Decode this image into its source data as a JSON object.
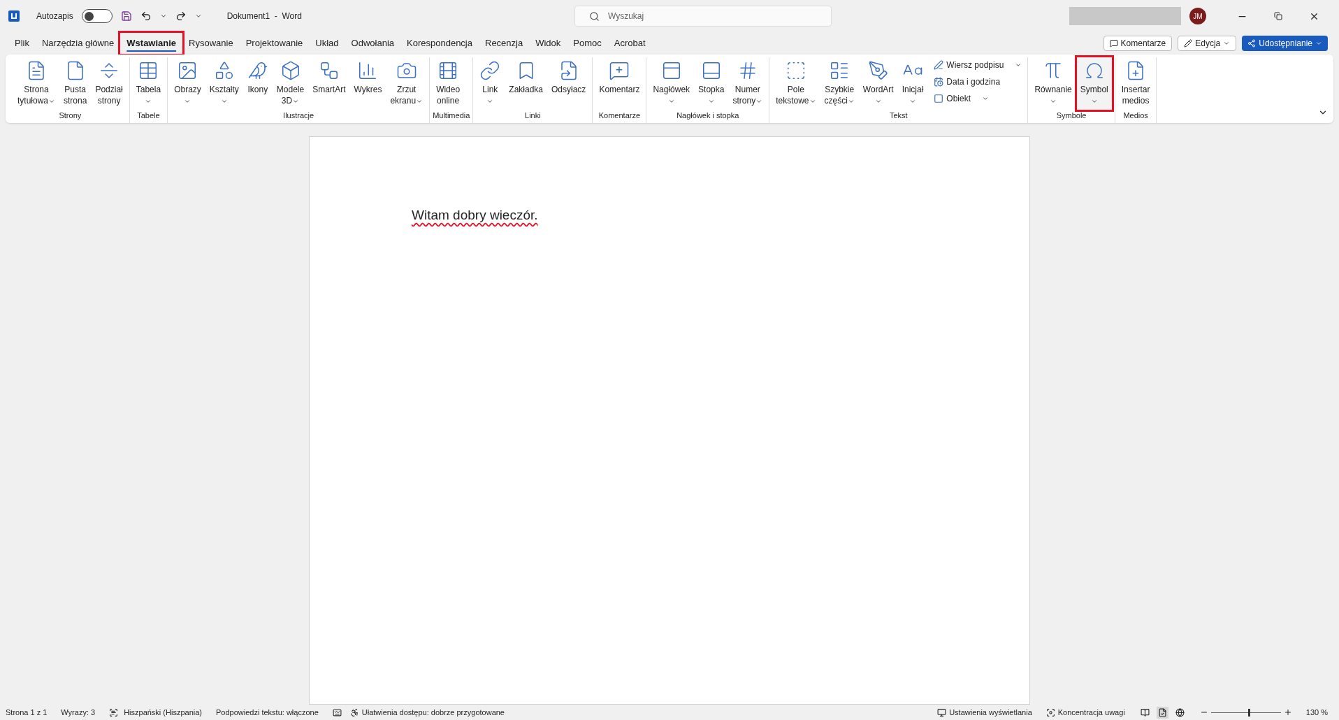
{
  "title_bar": {
    "autosave": {
      "label": "Autozapis",
      "on": false
    },
    "title": "Dokument1  -  Word",
    "search": {
      "placeholder": "Wyszukaj"
    },
    "avatar": "JM"
  },
  "tabs": [
    {
      "label": "Plik",
      "selected": false,
      "highlighted": false
    },
    {
      "label": "Narzędzia główne",
      "selected": false,
      "highlighted": false
    },
    {
      "label": "Wstawianie",
      "selected": true,
      "highlighted": true
    },
    {
      "label": "Rysowanie",
      "selected": false,
      "highlighted": false
    },
    {
      "label": "Projektowanie",
      "selected": false,
      "highlighted": false
    },
    {
      "label": "Układ",
      "selected": false,
      "highlighted": false
    },
    {
      "label": "Odwołania",
      "selected": false,
      "highlighted": false
    },
    {
      "label": "Korespondencja",
      "selected": false,
      "highlighted": false
    },
    {
      "label": "Recenzja",
      "selected": false,
      "highlighted": false
    },
    {
      "label": "Widok",
      "selected": false,
      "highlighted": false
    },
    {
      "label": "Pomoc",
      "selected": false,
      "highlighted": false
    },
    {
      "label": "Acrobat",
      "selected": false,
      "highlighted": false
    }
  ],
  "tab_actions": {
    "comments": "Komentarze",
    "editing": "Edycja",
    "share": "Udostępnianie"
  },
  "ribbon": [
    {
      "name": "Strony",
      "buttons": [
        {
          "kind": "large",
          "lines": [
            "Strona",
            "tytułowa"
          ],
          "dropdown": true,
          "highlighted": false
        },
        {
          "kind": "large",
          "lines": [
            "Pusta",
            "strona"
          ],
          "dropdown": false,
          "highlighted": false
        },
        {
          "kind": "large",
          "lines": [
            "Podział",
            "strony"
          ],
          "dropdown": false,
          "highlighted": false
        }
      ]
    },
    {
      "name": "Tabele",
      "buttons": [
        {
          "kind": "large",
          "lines": [
            "Tabela"
          ],
          "dropdown": true,
          "highlighted": false
        }
      ]
    },
    {
      "name": "Ilustracje",
      "buttons": [
        {
          "kind": "large",
          "lines": [
            "Obrazy"
          ],
          "dropdown": true,
          "highlighted": false
        },
        {
          "kind": "large",
          "lines": [
            "Kształty"
          ],
          "dropdown": true,
          "highlighted": false
        },
        {
          "kind": "large",
          "lines": [
            "Ikony"
          ],
          "dropdown": false,
          "highlighted": false
        },
        {
          "kind": "large",
          "lines": [
            "Modele",
            "3D"
          ],
          "dropdown": true,
          "highlighted": false
        },
        {
          "kind": "large",
          "lines": [
            "SmartArt"
          ],
          "dropdown": false,
          "highlighted": false
        },
        {
          "kind": "large",
          "lines": [
            "Wykres"
          ],
          "dropdown": false,
          "highlighted": false
        },
        {
          "kind": "large",
          "lines": [
            "Zrzut",
            "ekranu"
          ],
          "dropdown": true,
          "highlighted": false
        }
      ]
    },
    {
      "name": "Multimedia",
      "buttons": [
        {
          "kind": "large",
          "lines": [
            "Wideo",
            "online"
          ],
          "dropdown": false,
          "highlighted": false
        }
      ]
    },
    {
      "name": "Linki",
      "buttons": [
        {
          "kind": "large",
          "lines": [
            "Link"
          ],
          "dropdown": true,
          "highlighted": false
        },
        {
          "kind": "large",
          "lines": [
            "Zakładka"
          ],
          "dropdown": false,
          "highlighted": false
        },
        {
          "kind": "large",
          "lines": [
            "Odsyłacz"
          ],
          "dropdown": false,
          "highlighted": false
        }
      ]
    },
    {
      "name": "Komentarze",
      "buttons": [
        {
          "kind": "large",
          "lines": [
            "Komentarz"
          ],
          "dropdown": false,
          "highlighted": false
        }
      ]
    },
    {
      "name": "Nagłówek i stopka",
      "buttons": [
        {
          "kind": "large",
          "lines": [
            "Nagłówek"
          ],
          "dropdown": true,
          "highlighted": false
        },
        {
          "kind": "large",
          "lines": [
            "Stopka"
          ],
          "dropdown": true,
          "highlighted": false
        },
        {
          "kind": "large",
          "lines": [
            "Numer",
            "strony"
          ],
          "dropdown": true,
          "highlighted": false
        }
      ]
    },
    {
      "name": "Tekst",
      "buttons": [
        {
          "kind": "large",
          "lines": [
            "Pole",
            "tekstowe"
          ],
          "dropdown": true,
          "highlighted": false
        },
        {
          "kind": "large",
          "lines": [
            "Szybkie",
            "części"
          ],
          "dropdown": true,
          "highlighted": false
        },
        {
          "kind": "large",
          "lines": [
            "WordArt"
          ],
          "dropdown": true,
          "highlighted": false
        },
        {
          "kind": "large",
          "lines": [
            "Inicjał"
          ],
          "dropdown": true,
          "highlighted": false
        },
        {
          "kind": "small",
          "lines": [
            "Wiersz podpisu"
          ],
          "dropdown": true,
          "highlighted": false
        },
        {
          "kind": "small",
          "lines": [
            "Data i godzina"
          ],
          "dropdown": false,
          "highlighted": false
        },
        {
          "kind": "small",
          "lines": [
            "Obiekt"
          ],
          "dropdown": true,
          "highlighted": false
        }
      ]
    },
    {
      "name": "Symbole",
      "buttons": [
        {
          "kind": "large",
          "lines": [
            "Równanie"
          ],
          "dropdown": true,
          "highlighted": false
        },
        {
          "kind": "large",
          "lines": [
            "Symbol"
          ],
          "dropdown": true,
          "highlighted": true
        }
      ]
    },
    {
      "name": "Medios",
      "buttons": [
        {
          "kind": "large",
          "lines": [
            "Insertar",
            "medios"
          ],
          "dropdown": false,
          "highlighted": false
        }
      ]
    }
  ],
  "document": {
    "text": "Witam dobry wieczór.",
    "spelling_marked": true
  },
  "status_bar": {
    "left": [
      "Strona 1 z 1",
      "Wyrazy: 3",
      "Hiszpański (Hiszpania)",
      "Podpowiedzi tekstu: włączone",
      "Ułatwienia dostępu: dobrze przygotowane"
    ],
    "display_settings": "Ustawienia wyświetlania",
    "focus": "Koncentracja uwagi",
    "views": [
      {
        "selected": false
      },
      {
        "selected": true
      },
      {
        "selected": false
      }
    ],
    "zoom": {
      "level": 0.53,
      "reading": "130 %"
    }
  }
}
